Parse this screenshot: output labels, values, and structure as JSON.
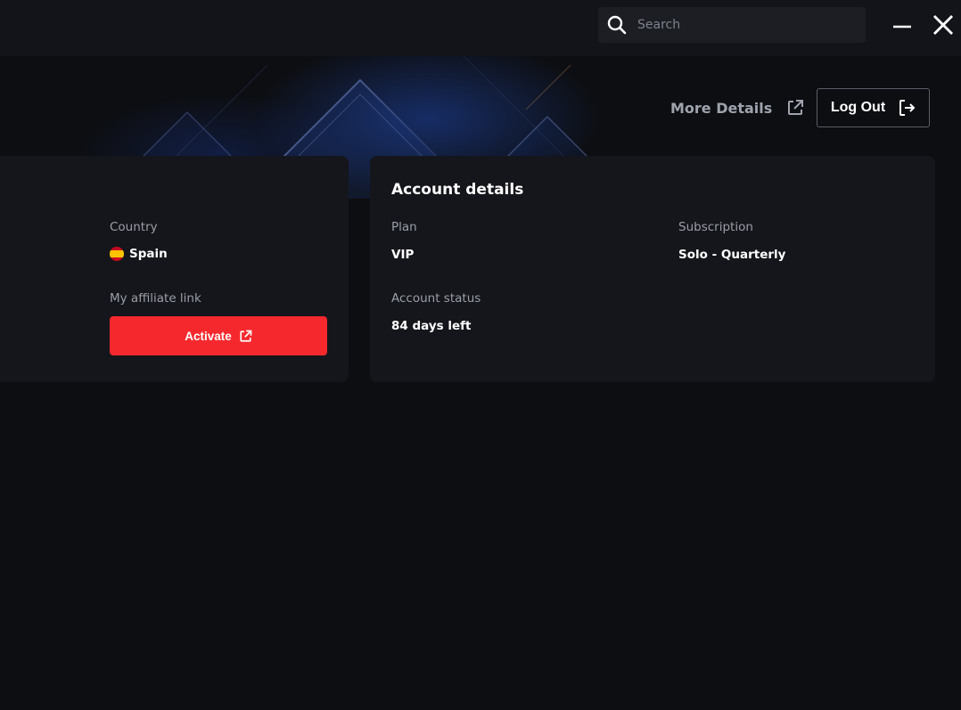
{
  "search": {
    "placeholder": "Search",
    "icon": "search-icon"
  },
  "window_controls": {
    "minimize_icon": "minimize-icon",
    "close_icon": "close-icon"
  },
  "header": {
    "more_details_label": "More Details",
    "logout_label": "Log Out"
  },
  "profile_card": {
    "country_label": "Country",
    "country_value": "Spain",
    "affiliate_label": "My affiliate link",
    "activate_label": "Activate"
  },
  "account_details": {
    "title": "Account details",
    "plan_label": "Plan",
    "plan_value": "VIP",
    "subscription_label": "Subscription",
    "subscription_value": "Solo - Quarterly",
    "status_label": "Account status",
    "status_value": "84 days left"
  },
  "colors": {
    "accent": "#f5282d",
    "background": "#0d0e12",
    "card": "#15161b"
  }
}
